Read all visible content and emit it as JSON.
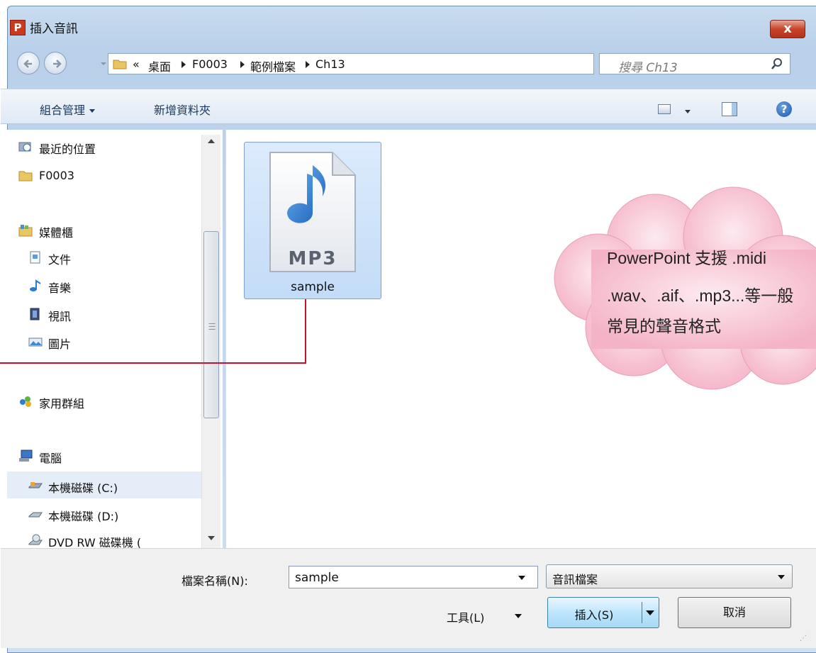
{
  "window": {
    "title": "插入音訊",
    "app_icon_letter": "P",
    "close_symbol": "x"
  },
  "address_bar": {
    "overflow": "«",
    "crumbs": [
      "桌面",
      "F0003",
      "範例檔案",
      "Ch13"
    ]
  },
  "search": {
    "placeholder": "搜尋 Ch13"
  },
  "toolbar": {
    "organize_label": "組合管理",
    "new_folder_label": "新增資料夾"
  },
  "nav_pane": {
    "items": [
      {
        "label": "最近的位置",
        "icon": "recent-places-icon"
      },
      {
        "label": "F0003",
        "icon": "folder-icon"
      },
      {
        "label": "媒體櫃",
        "icon": "libraries-icon"
      },
      {
        "label": "文件",
        "icon": "documents-icon"
      },
      {
        "label": "音樂",
        "icon": "music-icon"
      },
      {
        "label": "視訊",
        "icon": "videos-icon"
      },
      {
        "label": "圖片",
        "icon": "pictures-icon"
      },
      {
        "label": "家用群組",
        "icon": "homegroup-icon"
      },
      {
        "label": "電腦",
        "icon": "computer-icon"
      },
      {
        "label": "本機磁碟 (C:)",
        "icon": "drive-c-icon"
      },
      {
        "label": "本機磁碟 (D:)",
        "icon": "drive-d-icon"
      },
      {
        "label": "DVD RW 磁碟機 (",
        "icon": "dvd-drive-icon"
      }
    ],
    "selected": "本機磁碟 (C:)"
  },
  "files": [
    {
      "name": "sample",
      "badge": "MP3",
      "icon": "mp3-file-icon",
      "selected": true
    }
  ],
  "callout": {
    "lines": [
      "PowerPoint 支援 .midi",
      ".wav、.aif、.mp3...等一般",
      "常見的聲音格式"
    ]
  },
  "footer": {
    "filename_label": "檔案名稱(N):",
    "filename_value": "sample",
    "filetype_value": "音訊檔案",
    "tools_label": "工具(L)",
    "insert_label": "插入(S)",
    "cancel_label": "取消"
  },
  "colors": {
    "callout_fill": "#f9ccd9",
    "callout_line": "#c8102e",
    "selection": "#cfe3fb"
  }
}
